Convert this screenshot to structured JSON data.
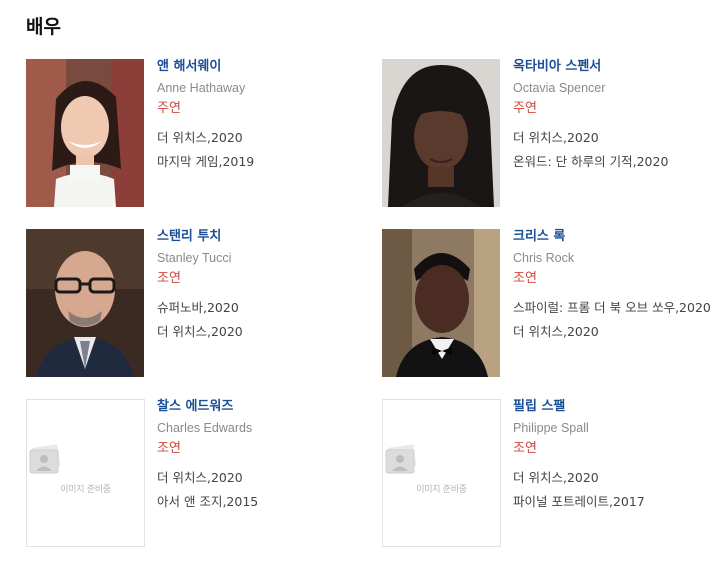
{
  "section": {
    "title": "배우"
  },
  "placeholder_text": "이미지 준비중",
  "cast": [
    {
      "name_ko": "앤 해서웨이",
      "name_en": "Anne Hathaway",
      "role": "주연",
      "works": [
        "더 위치스,2020",
        "마지막 게임,2019"
      ],
      "photo": "anne-hathaway-photo"
    },
    {
      "name_ko": "옥타비아 스펜서",
      "name_en": "Octavia Spencer",
      "role": "주연",
      "works": [
        "더 위치스,2020",
        "온워드: 단 하루의 기적,2020"
      ],
      "photo": "octavia-spencer-photo"
    },
    {
      "name_ko": "스탠리 투치",
      "name_en": "Stanley Tucci",
      "role": "조연",
      "works": [
        "슈퍼노바,2020",
        "더 위치스,2020"
      ],
      "photo": "stanley-tucci-photo"
    },
    {
      "name_ko": "크리스 록",
      "name_en": "Chris Rock",
      "role": "조연",
      "works": [
        "스파이럴: 프롬 더 북 오브 쏘우,2020",
        "더 위치스,2020"
      ],
      "photo": "chris-rock-photo"
    },
    {
      "name_ko": "찰스 에드워즈",
      "name_en": "Charles Edwards",
      "role": "조연",
      "works": [
        "더 위치스,2020",
        "아서 앤 조지,2015"
      ],
      "photo": null
    },
    {
      "name_ko": "필립 스팰",
      "name_en": "Philippe Spall",
      "role": "조연",
      "works": [
        "더 위치스,2020",
        "파이널 포트레이트,2017"
      ],
      "photo": null
    }
  ]
}
